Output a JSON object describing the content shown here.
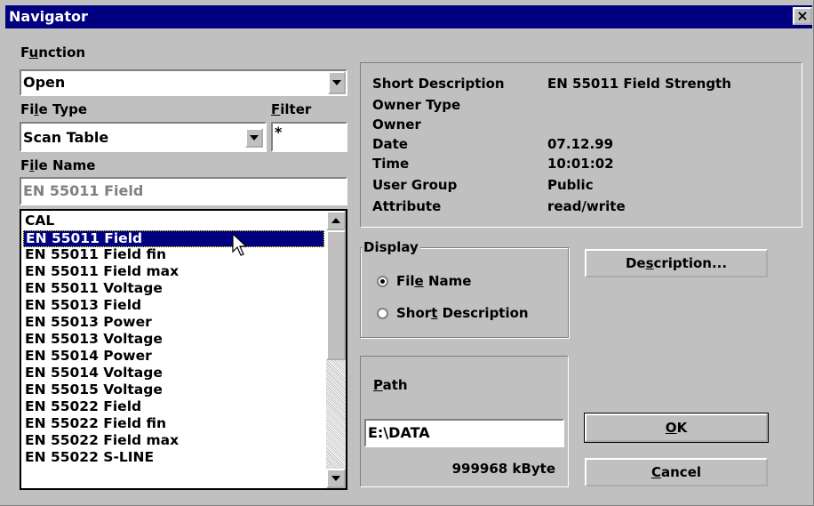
{
  "window": {
    "title": "Navigator",
    "close": "×"
  },
  "function": {
    "label_pre": "F",
    "label_u": "u",
    "label_post": "nction",
    "value": "Open"
  },
  "file_type": {
    "label_pre": "Fi",
    "label_u": "l",
    "label_post": "e Type",
    "value": "Scan Table"
  },
  "filter": {
    "label_u": "F",
    "label_post": "ilter",
    "value": "*"
  },
  "file_name": {
    "label_pre": "F",
    "label_u": "i",
    "label_post": "le Name",
    "value": "EN 55011 Field"
  },
  "file_list": {
    "items": [
      "CAL",
      "EN 55011 Field",
      "EN 55011 Field fin",
      "EN 55011 Field max",
      "EN 55011 Voltage",
      "EN 55013 Field",
      "EN 55013 Power",
      "EN 55013 Voltage",
      "EN 55014 Power",
      "EN 55014 Voltage",
      "EN 55015 Voltage",
      "EN 55022 Field",
      "EN 55022 Field fin",
      "EN 55022 Field max",
      "EN 55022 S-LINE"
    ],
    "selected": "EN 55011 Field"
  },
  "info": {
    "short_description_label": "Short Description",
    "short_description": "EN 55011 Field Strength",
    "owner_type_label": "Owner Type",
    "owner_type": "",
    "owner_label": "Owner",
    "owner": "",
    "date_label": "Date",
    "date": "07.12.99",
    "time_label": "Time",
    "time": "10:01:02",
    "user_group_label": "User Group",
    "user_group": "Public",
    "attribute_label": "Attribute",
    "attribute": "read/write"
  },
  "display": {
    "legend": "Display",
    "option_file_name": {
      "pre": "Fil",
      "u": "e",
      "post": " Name",
      "checked": true
    },
    "option_short_desc": {
      "pre": "Shor",
      "u": "t",
      "post": " Description",
      "checked": false
    }
  },
  "path": {
    "label_u": "P",
    "label_post": "ath",
    "value": "E:\\DATA",
    "free": "999968 kByte"
  },
  "buttons": {
    "description": {
      "pre": "De",
      "u": "s",
      "post": "cription..."
    },
    "ok": {
      "u": "O",
      "post": "K"
    },
    "cancel": {
      "u": "C",
      "post": "ancel"
    }
  }
}
